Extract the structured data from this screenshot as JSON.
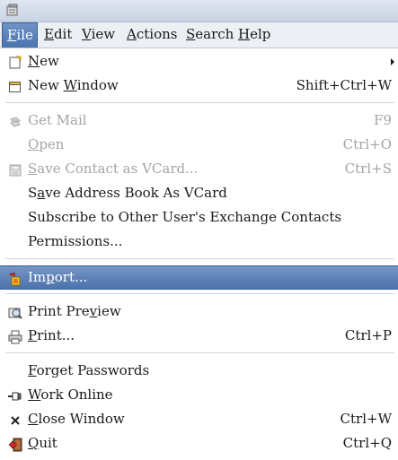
{
  "menubar": {
    "items": [
      {
        "label": "File",
        "mnemonic": "F",
        "rest": "ile",
        "active": true
      },
      {
        "label": "Edit",
        "mnemonic": "E",
        "rest": "dit"
      },
      {
        "label": "View",
        "mnemonic": "V",
        "rest": "iew"
      },
      {
        "label": "Actions",
        "mnemonic": "A",
        "rest": "ctions"
      },
      {
        "label": "Search",
        "mnemonic": "S",
        "rest": "earch"
      },
      {
        "label": "Help",
        "mnemonic": "H",
        "rest": "elp"
      }
    ]
  },
  "file_menu": {
    "items": [
      {
        "label": "New",
        "pre": "",
        "mn": "N",
        "post": "ew",
        "accel": "",
        "icon": "new-document-icon",
        "submenu": true
      },
      {
        "label": "New Window",
        "pre": "New ",
        "mn": "W",
        "post": "indow",
        "accel": "Shift+Ctrl+W",
        "icon": "new-window-icon"
      },
      {
        "label": "Get Mail",
        "pre": "Get Mail",
        "mn": "",
        "post": "",
        "accel": "F9",
        "icon": "send-receive-icon",
        "disabled": true
      },
      {
        "label": "Open",
        "pre": "",
        "mn": "O",
        "post": "pen",
        "accel": "Ctrl+O",
        "disabled": true
      },
      {
        "label": "Save Contact as VCard...",
        "pre": "",
        "mn": "S",
        "post": "ave Contact as VCard...",
        "accel": "Ctrl+S",
        "icon": "save-icon",
        "disabled": true
      },
      {
        "label": "Save Address Book As VCard",
        "pre": "S",
        "mn": "a",
        "post": "ve Address Book As VCard",
        "accel": ""
      },
      {
        "label": "Subscribe to Other User's Exchange Contacts",
        "pre": "Subscribe to Other User's Exchange Contacts",
        "mn": "",
        "post": "",
        "accel": ""
      },
      {
        "label": "Permissions...",
        "pre": "Permissions...",
        "mn": "",
        "post": "",
        "accel": ""
      },
      {
        "label": "Import...",
        "pre": "Im",
        "mn": "p",
        "post": "ort...",
        "accel": "",
        "icon": "import-icon",
        "highlighted": true
      },
      {
        "label": "Print Preview",
        "pre": "Print Pre",
        "mn": "v",
        "post": "iew",
        "accel": "",
        "icon": "print-preview-icon"
      },
      {
        "label": "Print...",
        "pre": "",
        "mn": "P",
        "post": "rint...",
        "accel": "Ctrl+P",
        "icon": "printer-icon"
      },
      {
        "label": "Forget Passwords",
        "pre": "",
        "mn": "F",
        "post": "orget Passwords",
        "accel": ""
      },
      {
        "label": "Work Online",
        "pre": "",
        "mn": "W",
        "post": "ork Online",
        "accel": "",
        "icon": "work-online-icon"
      },
      {
        "label": "Close Window",
        "pre": "",
        "mn": "C",
        "post": "lose Window",
        "accel": "Ctrl+W",
        "icon": "close-icon"
      },
      {
        "label": "Quit",
        "pre": "",
        "mn": "Q",
        "post": "uit",
        "accel": "Ctrl+Q",
        "icon": "quit-icon"
      }
    ]
  }
}
